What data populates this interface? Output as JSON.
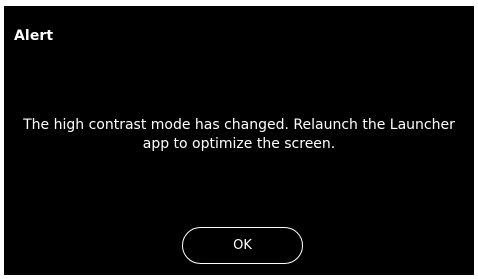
{
  "dialog": {
    "title": "Alert",
    "message": "The high contrast mode has changed. Relaunch the Launcher app to optimize the screen.",
    "ok_label": "OK"
  },
  "colors": {
    "background": "#000000",
    "text": "#ffffff",
    "button_border": "#ffffff"
  }
}
